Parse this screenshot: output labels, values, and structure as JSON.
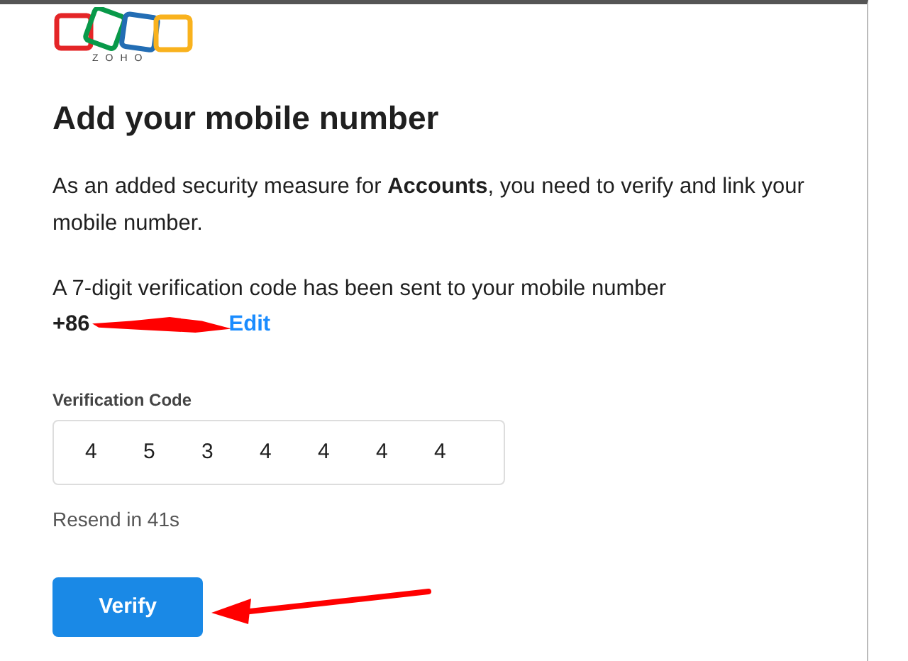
{
  "logo": {
    "text": "ZOHO"
  },
  "title": "Add your mobile number",
  "intro": "As an added security measure for **Accounts**, you need to verify and link your mobile number.",
  "notice": "A 7-digit verification code has been sent to your mobile number",
  "phone": {
    "visible": "+86",
    "redacted": true,
    "edit_link": "Edit"
  },
  "code_field": {
    "label": "Verification Code",
    "digits": [
      "4",
      "5",
      "3",
      "4",
      "4",
      "4",
      "4"
    ]
  },
  "resend": "Resend in 41s",
  "verify_button": "Verify",
  "annotations": [
    {
      "kind": "arrow",
      "color": "#ff0000"
    }
  ]
}
